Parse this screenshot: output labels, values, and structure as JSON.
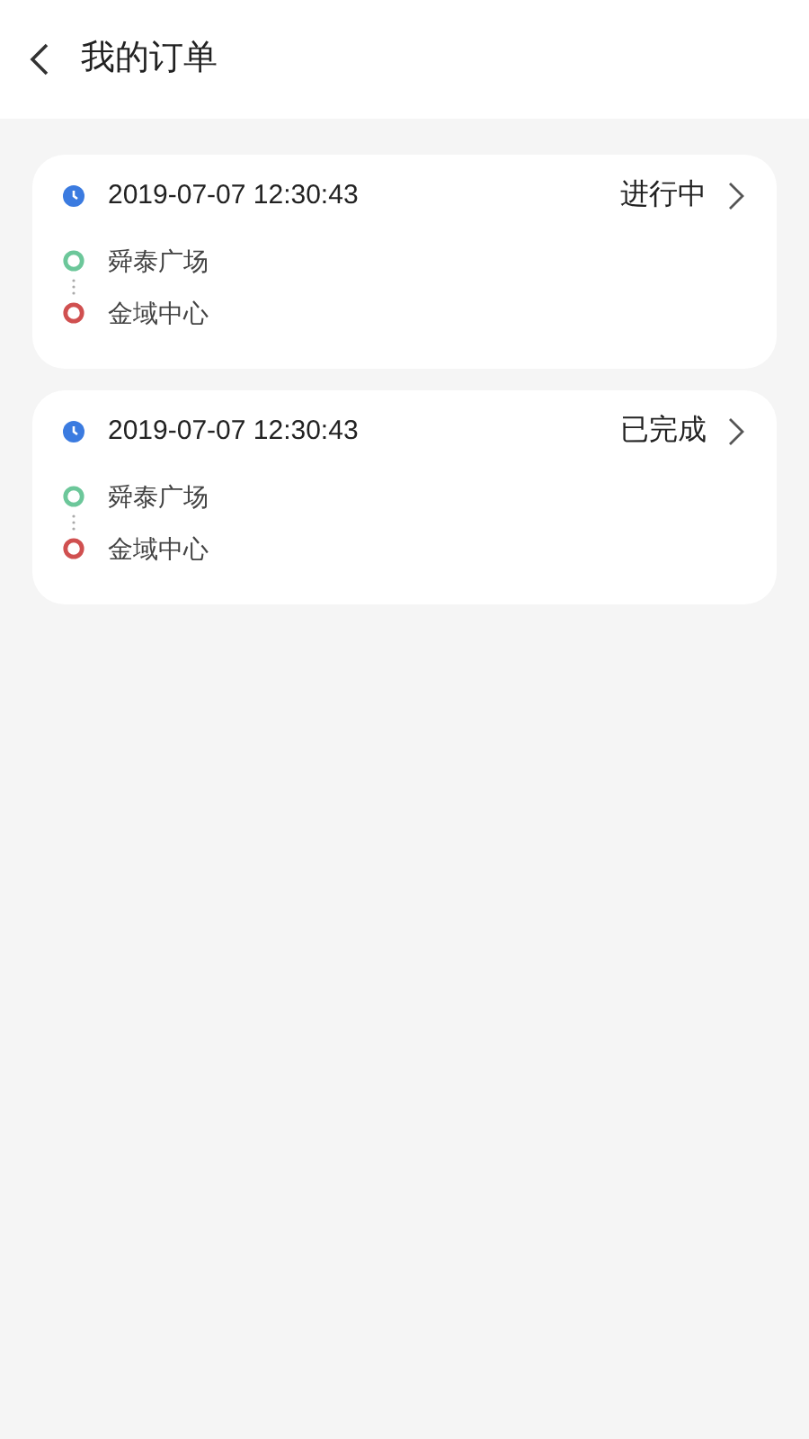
{
  "header": {
    "title": "我的订单"
  },
  "orders": [
    {
      "time": "2019-07-07 12:30:43",
      "status": "进行中",
      "start": "舜泰广场",
      "end": "金域中心"
    },
    {
      "time": "2019-07-07 12:30:43",
      "status": "已完成",
      "start": "舜泰广场",
      "end": "金域中心"
    }
  ]
}
